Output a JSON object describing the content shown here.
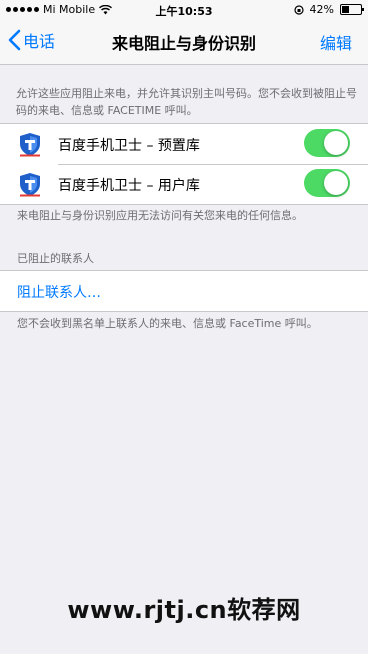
{
  "status_bar": {
    "carrier": "Mi Mobile",
    "time": "上午10:53",
    "battery": "42%",
    "battery_level": 0.42
  },
  "nav": {
    "back_label": "电话",
    "title": "来电阻止与身份识别",
    "edit_label": "编辑"
  },
  "intro_text": "允许这些应用阻止来电，并允许其识别主叫号码。您不会收到被阻止号码的来电、信息或 FACETIME 呼叫。",
  "apps": [
    {
      "label": "百度手机卫士 – 预置库",
      "enabled": true,
      "icon": "baidu-shield-icon"
    },
    {
      "label": "百度手机卫士 – 用户库",
      "enabled": true,
      "icon": "baidu-shield-icon"
    }
  ],
  "apps_footer": "来电阻止与身份识别应用无法访问有关您来电的任何信息。",
  "blocked_section": {
    "header": "已阻止的联系人",
    "block_link": "阻止联系人…",
    "footer": "您不会收到黑名单上联系人的来电、信息或 FaceTime 呼叫。"
  },
  "watermark": "www.rjtj.cn软荐网",
  "colors": {
    "accent": "#007aff",
    "toggle_on": "#4cd964",
    "background": "#efeff4"
  }
}
